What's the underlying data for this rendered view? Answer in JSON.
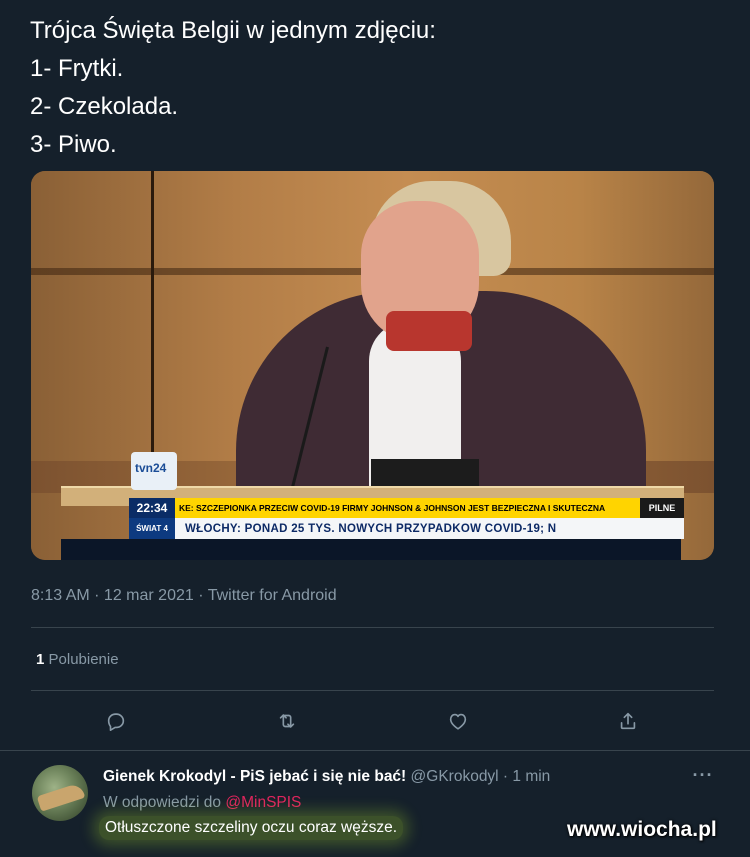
{
  "tweet": {
    "text_lines": [
      "Trójca Święta Belgii w jednym zdjęciu:",
      "1- Frytki.",
      "2- Czekolada.",
      "3- Piwo."
    ],
    "timestamp": "8:13 AM · 12 mar 2021 · Twitter for Android",
    "likes_count": "1",
    "likes_label": "Polubienie"
  },
  "media": {
    "channel_logo": "tvn24",
    "ticker_time": "22:34",
    "ticker_headline": "KE: SZCZEPIONKA PRZECIW COVID-19 FIRMY JOHNSON & JOHNSON JEST BEZPIECZNA I SKUTECZNA",
    "ticker_tag": "PILNE",
    "ticker_section": "ŚWIAT 4",
    "ticker_line": "WŁOCHY: PONAD 25 TYS. NOWYCH PRZYPADKÓW COVID-19; N"
  },
  "actions": [
    "reply-icon",
    "retweet-icon",
    "like-icon",
    "share-icon"
  ],
  "reply": {
    "name": "Gienek Krokodyl - PiS jebać i się nie bać!",
    "handle_time": "@GKrokodyl · 1 min",
    "reply_to_label": "W odpowiedzi do",
    "reply_to_handle": "@MinSPIS",
    "text": "Otłuszczone szczeliny oczu coraz węższe.",
    "more": "···"
  },
  "watermark": "www.wiocha.pl",
  "colors": {
    "background": "#15202b",
    "secondary_text": "#8899a6",
    "divider": "#38444d",
    "mention": "#e0245e"
  }
}
